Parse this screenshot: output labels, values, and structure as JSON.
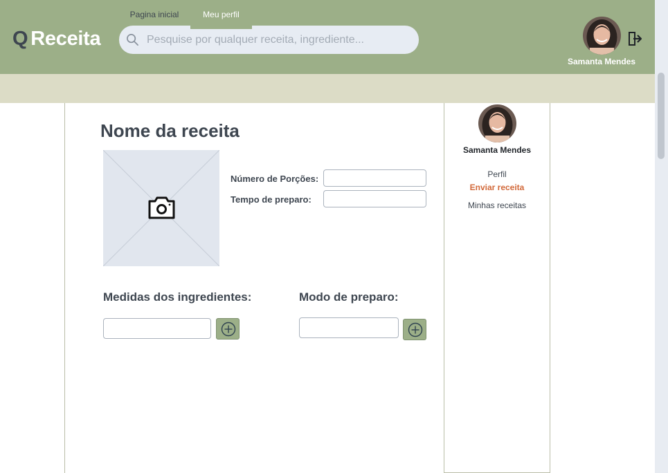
{
  "header": {
    "logo_q": "Q",
    "logo_text": "Receita",
    "search_placeholder": "Pesquise por qualquer receita, ingrediente...",
    "search_icon": "search-icon",
    "user_name": "Samanta Mendes",
    "logout_icon": "logout-icon"
  },
  "nav": {
    "tabs": [
      {
        "label": "Pagina inicial",
        "active": false
      },
      {
        "label": "Meu perfil",
        "active": true
      }
    ]
  },
  "form": {
    "title": "Nome da receita",
    "photo_icon": "camera-icon",
    "portions_label": "Número de Porções:",
    "portions_value": "",
    "prep_time_label": "Tempo de preparo:",
    "prep_time_value": "",
    "ingredients_heading": "Medidas dos ingredientes:",
    "ingredient_value": "",
    "method_heading": "Modo de preparo:",
    "method_value": "",
    "add_icon": "plus-circle-icon"
  },
  "sidebar": {
    "user_name": "Samanta Mendes",
    "links": [
      {
        "label": "Perfil",
        "active": false
      },
      {
        "label": "Enviar receita",
        "active": true
      },
      {
        "label": "Minhas receitas",
        "active": false
      }
    ]
  },
  "colors": {
    "header_bg": "#9caf88",
    "nav_bg": "#dcdcc6",
    "accent_orange": "#d2693a",
    "text_dark": "#3e4650",
    "search_bg": "#e7ecf3"
  }
}
